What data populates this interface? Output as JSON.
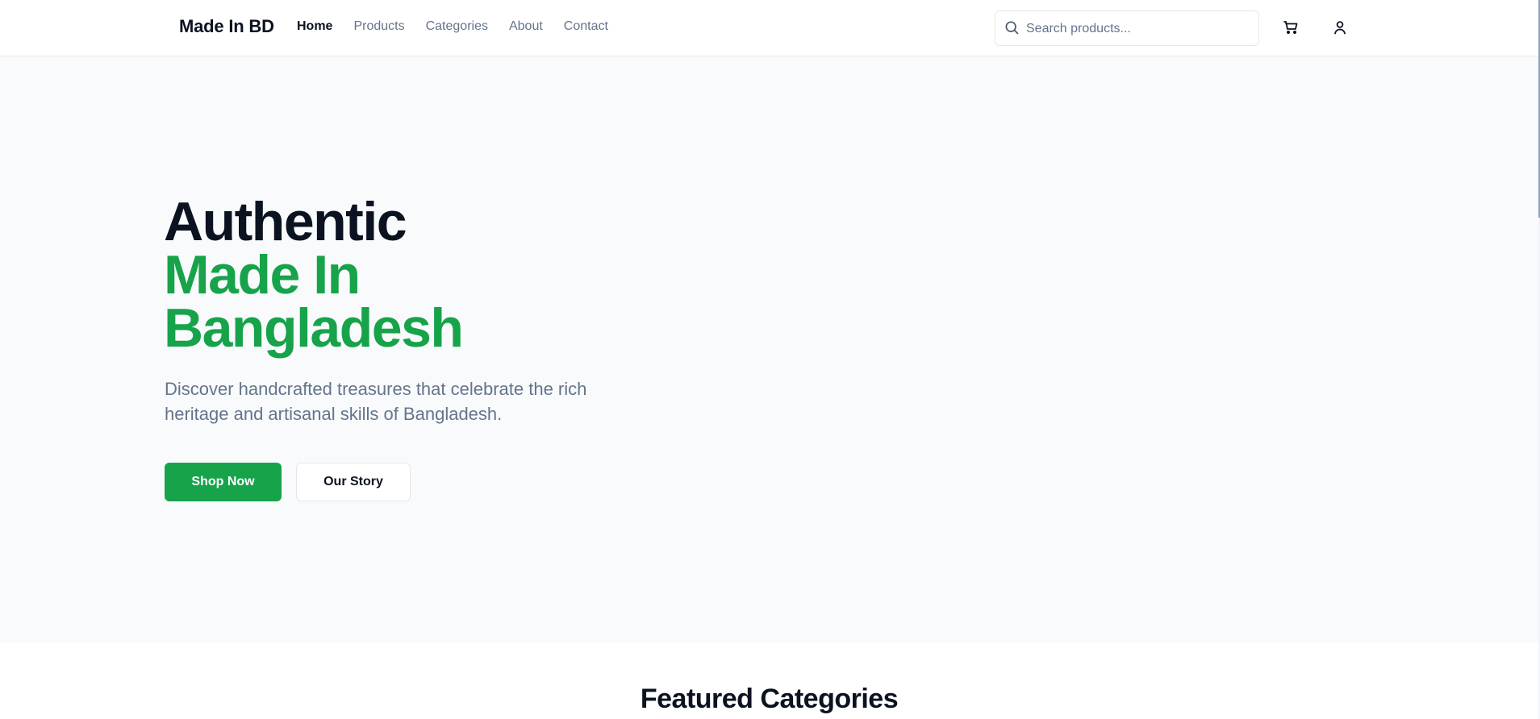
{
  "header": {
    "brand": "Made In BD",
    "nav": [
      {
        "label": "Home",
        "active": true
      },
      {
        "label": "Products",
        "active": false
      },
      {
        "label": "Categories",
        "active": false
      },
      {
        "label": "About",
        "active": false
      },
      {
        "label": "Contact",
        "active": false
      }
    ],
    "search": {
      "placeholder": "Search products...",
      "value": "",
      "icon": "search-icon"
    },
    "icons": {
      "cart": "shopping-cart-icon",
      "user": "user-icon"
    }
  },
  "hero": {
    "title_line1": "Authentic",
    "title_line2": "Made In",
    "title_line3": "Bangladesh",
    "subtitle": "Discover handcrafted treasures that celebrate the rich heritage and artisanal skills of Bangladesh.",
    "primary_button": "Shop Now",
    "secondary_button": "Our Story"
  },
  "featured": {
    "title": "Featured Categories"
  },
  "colors": {
    "accent": "#16a34a",
    "text_dark": "#0b1220",
    "text_muted": "#64748b",
    "hero_bg": "#f8fafc",
    "border": "#e5e7eb"
  }
}
